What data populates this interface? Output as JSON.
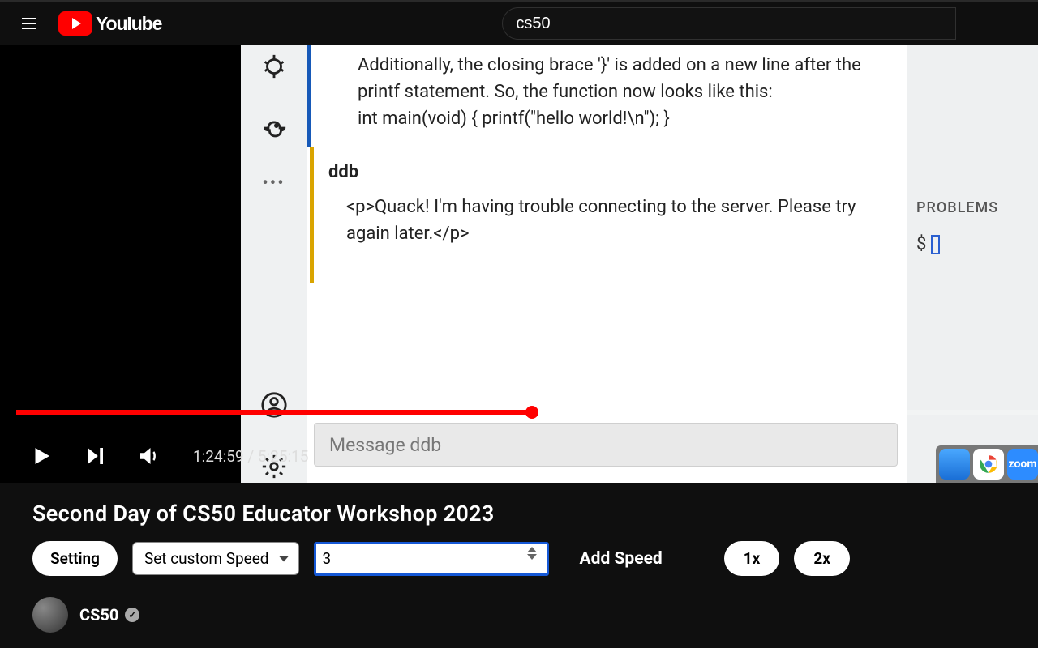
{
  "header": {
    "logo_text": "YouIube",
    "search_value": "cs50"
  },
  "video": {
    "chat_upper_lines": [
      "Additionally, the closing brace '}' is added on a new line after the printf statement. So, the function now looks like this:",
      "int main(void) { printf(\"hello world!\\n\"); }"
    ],
    "chat_msg": {
      "sender": "ddb",
      "body": "<p>Quack! I'm having trouble connecting to the server. Please try again later.</p>"
    },
    "chat_placeholder": "Message ddb",
    "problems_header": "PROBLEMS",
    "prompt_symbol": "$",
    "time_current": "1:24:59",
    "time_total": "5:25:15"
  },
  "page": {
    "title": "Second Day of CS50 Educator Workshop 2023",
    "setting_label": "Setting",
    "custom_speed_label": "Set custom Speed",
    "custom_speed_value": "3",
    "add_speed_label": "Add Speed",
    "speed_1": "1x",
    "speed_2": "2x",
    "channel_name": "CS50"
  }
}
